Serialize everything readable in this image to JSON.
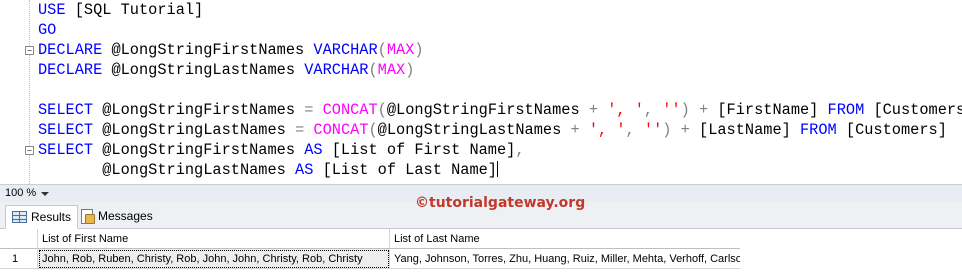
{
  "editor": {
    "lines": [
      [
        {
          "t": "USE",
          "c": "kw"
        },
        {
          "t": " [SQL Tutorial]",
          "c": ""
        }
      ],
      [
        {
          "t": "GO",
          "c": "kw"
        }
      ],
      [
        {
          "t": "DECLARE",
          "c": "kw"
        },
        {
          "t": " @LongStringFirstNames ",
          "c": ""
        },
        {
          "t": "VARCHAR",
          "c": "kw"
        },
        {
          "t": "(",
          "c": "op"
        },
        {
          "t": "MAX",
          "c": "fn"
        },
        {
          "t": ")",
          "c": "op"
        }
      ],
      [
        {
          "t": "DECLARE",
          "c": "kw"
        },
        {
          "t": " @LongStringLastNames ",
          "c": ""
        },
        {
          "t": "VARCHAR",
          "c": "kw"
        },
        {
          "t": "(",
          "c": "op"
        },
        {
          "t": "MAX",
          "c": "fn"
        },
        {
          "t": ")",
          "c": "op"
        }
      ],
      [],
      [
        {
          "t": "SELECT",
          "c": "kw"
        },
        {
          "t": " @LongStringFirstNames ",
          "c": ""
        },
        {
          "t": "=",
          "c": "op"
        },
        {
          "t": " ",
          "c": ""
        },
        {
          "t": "CONCAT",
          "c": "fn"
        },
        {
          "t": "(",
          "c": "op"
        },
        {
          "t": "@LongStringFirstNames ",
          "c": ""
        },
        {
          "t": "+",
          "c": "op"
        },
        {
          "t": " ",
          "c": ""
        },
        {
          "t": "', '",
          "c": "str"
        },
        {
          "t": ",",
          "c": "op"
        },
        {
          "t": " ",
          "c": ""
        },
        {
          "t": "''",
          "c": "str"
        },
        {
          "t": ")",
          "c": "op"
        },
        {
          "t": " ",
          "c": ""
        },
        {
          "t": "+",
          "c": "op"
        },
        {
          "t": " [FirstName] ",
          "c": ""
        },
        {
          "t": "FROM",
          "c": "kw"
        },
        {
          "t": " [Customers]",
          "c": ""
        }
      ],
      [
        {
          "t": "SELECT",
          "c": "kw"
        },
        {
          "t": " @LongStringLastNames ",
          "c": ""
        },
        {
          "t": "=",
          "c": "op"
        },
        {
          "t": " ",
          "c": ""
        },
        {
          "t": "CONCAT",
          "c": "fn"
        },
        {
          "t": "(",
          "c": "op"
        },
        {
          "t": "@LongStringLastNames ",
          "c": ""
        },
        {
          "t": "+",
          "c": "op"
        },
        {
          "t": " ",
          "c": ""
        },
        {
          "t": "', '",
          "c": "str"
        },
        {
          "t": ",",
          "c": "op"
        },
        {
          "t": " ",
          "c": ""
        },
        {
          "t": "''",
          "c": "str"
        },
        {
          "t": ")",
          "c": "op"
        },
        {
          "t": " ",
          "c": ""
        },
        {
          "t": "+",
          "c": "op"
        },
        {
          "t": " [LastName] ",
          "c": ""
        },
        {
          "t": "FROM",
          "c": "kw"
        },
        {
          "t": " [Customers]",
          "c": ""
        }
      ],
      [
        {
          "t": "SELECT",
          "c": "kw"
        },
        {
          "t": " @LongStringFirstNames ",
          "c": ""
        },
        {
          "t": "AS",
          "c": "kw"
        },
        {
          "t": " [List of First Name]",
          "c": ""
        },
        {
          "t": ",",
          "c": "op"
        }
      ],
      [
        {
          "t": "       @LongStringLastNames ",
          "c": ""
        },
        {
          "t": "AS",
          "c": "kw"
        },
        {
          "t": " [List of Last Name]",
          "c": ""
        }
      ]
    ],
    "collapse_markers": [
      "−",
      "−"
    ]
  },
  "zoom": {
    "value": "100 %"
  },
  "tabs": {
    "results_label": "Results",
    "messages_label": "Messages"
  },
  "watermark": "©tutorialgateway.org",
  "grid": {
    "headers": [
      "List of First Name",
      "List of Last Name"
    ],
    "rows": [
      {
        "num": "1",
        "first": "John, Rob, Ruben, Christy, Rob, John, John, Christy, Rob, Christy",
        "last": "Yang, Johnson, Torres, Zhu, Huang, Ruiz, Miller, Mehta, Verhoff, Carlson"
      }
    ]
  },
  "colors": {
    "keyword": "#0000ff",
    "function": "#ff00ff",
    "string": "#ff0000",
    "operator": "#808080",
    "watermark": "#c0392b"
  }
}
